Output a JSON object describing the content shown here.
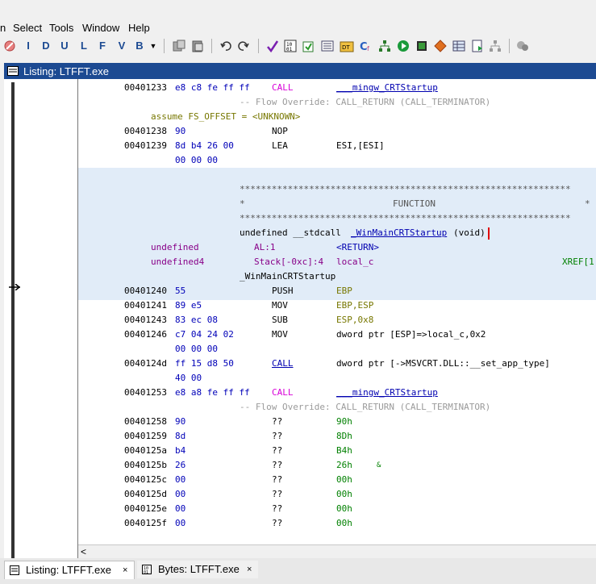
{
  "menu": {
    "items": [
      "n",
      "Select",
      "Tools",
      "Window",
      "Help"
    ]
  },
  "toolbar": {
    "letters": [
      "I",
      "D",
      "U",
      "L",
      "F",
      "V",
      "B"
    ]
  },
  "window": {
    "title": "Listing:  LTFFT.exe"
  },
  "listing": {
    "rows": [
      {
        "addr": "00401233",
        "bytes": "e8 c8 fe ff ff",
        "mnemonic": "CALL",
        "operand": "___mingw_CRTStartup"
      },
      {
        "flow": "-- Flow Override: CALL_RETURN (CALL_TERMINATOR)"
      },
      {
        "assume": "assume FS_OFFSET = <UNKNOWN>"
      },
      {
        "addr": "00401238",
        "bytes": "90",
        "mnemonic": "NOP"
      },
      {
        "addr": "00401239",
        "bytes": "8d b4 26 00",
        "mnemonic": "LEA",
        "operand": "ESI,[ESI]"
      },
      {
        "bytes": "00 00 00"
      }
    ],
    "function_header": {
      "stars1": "**************************************************************",
      "function_label": "FUNCTION",
      "stars2": "**************************************************************",
      "signature_prefix": "undefined __stdcall ",
      "signature_name": "_WinMainCRTStartup",
      "signature_suffix": "(void)",
      "param1_type": "undefined",
      "param1_loc": "AL:1",
      "param1_name": "<RETURN>",
      "param2_type": "undefined4",
      "param2_loc": "Stack[-0xc]:4",
      "param2_name": "local_c",
      "param2_xref": "XREF[1",
      "label": "_WinMainCRTStartup"
    },
    "rows2": [
      {
        "addr": "00401240",
        "bytes": "55",
        "mnemonic": "PUSH",
        "operand": "EBP"
      },
      {
        "addr": "00401241",
        "bytes": "89 e5",
        "mnemonic": "MOV",
        "operand": "EBP,ESP"
      },
      {
        "addr": "00401243",
        "bytes": "83 ec 08",
        "mnemonic": "SUB",
        "operand": "ESP,0x8"
      },
      {
        "addr": "00401246",
        "bytes": "c7 04 24 02",
        "mnemonic": "MOV",
        "operand": "dword ptr [ESP]=>local_c,0x2"
      },
      {
        "bytes": "00 00 00"
      },
      {
        "addr": "0040124d",
        "bytes": "ff 15 d8 50",
        "mnemonic": "CALL",
        "operand": "dword ptr [->MSVCRT.DLL::__set_app_type]"
      },
      {
        "bytes": "40 00"
      },
      {
        "addr": "00401253",
        "bytes": "e8 a8 fe ff ff",
        "mnemonic": "CALL",
        "operand": "___mingw_CRTStartup"
      },
      {
        "flow": "-- Flow Override: CALL_RETURN (CALL_TERMINATOR)"
      },
      {
        "addr": "00401258",
        "bytes": "90",
        "mnemonic": "??",
        "operand": "90h"
      },
      {
        "addr": "00401259",
        "bytes": "8d",
        "mnemonic": "??",
        "operand": "8Dh"
      },
      {
        "addr": "0040125a",
        "bytes": "b4",
        "mnemonic": "??",
        "operand": "B4h"
      },
      {
        "addr": "0040125b",
        "bytes": "26",
        "mnemonic": "??",
        "operand": "26h",
        "comment": "&"
      },
      {
        "addr": "0040125c",
        "bytes": "00",
        "mnemonic": "??",
        "operand": "00h"
      },
      {
        "addr": "0040125d",
        "bytes": "00",
        "mnemonic": "??",
        "operand": "00h"
      },
      {
        "addr": "0040125e",
        "bytes": "00",
        "mnemonic": "??",
        "operand": "00h"
      },
      {
        "addr": "0040125f",
        "bytes": "00",
        "mnemonic": "??",
        "operand": "00h"
      }
    ]
  },
  "tabs": [
    {
      "label": "Listing:  LTFFT.exe",
      "close": "×"
    },
    {
      "label": "Bytes: LTFFT.exe",
      "close": "×"
    }
  ],
  "colors": {
    "title_bar": "#1c4a92",
    "highlight": "#e1ecf8",
    "call": "#d800d8",
    "bytes": "#0000b8"
  }
}
